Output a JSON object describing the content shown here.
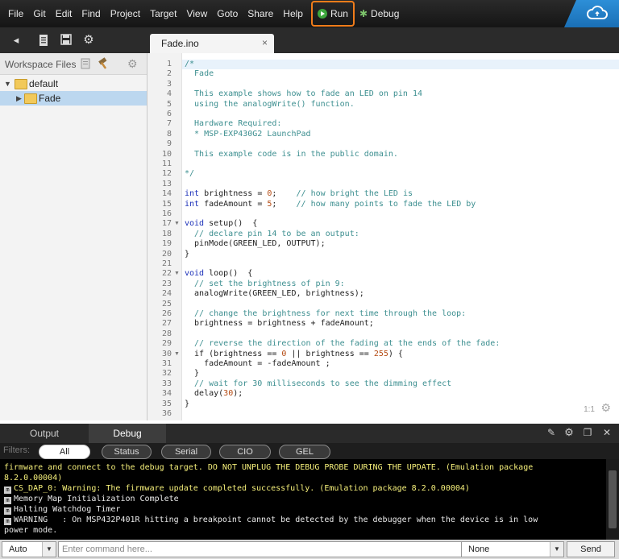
{
  "menu": {
    "items": [
      "File",
      "Git",
      "Edit",
      "Find",
      "Project",
      "Target",
      "View",
      "Goto",
      "Share",
      "Help"
    ],
    "run_label": "Run",
    "debug_label": "Debug"
  },
  "editor": {
    "tab_title": "Fade.ino",
    "cursor_position": "1:1",
    "line_numbers": [
      "1",
      "2",
      "3",
      "4",
      "5",
      "6",
      "7",
      "8",
      "9",
      "10",
      "11",
      "12",
      "13",
      "14",
      "15",
      "16",
      "17",
      "18",
      "19",
      "20",
      "21",
      "22",
      "23",
      "24",
      "25",
      "26",
      "27",
      "28",
      "29",
      "30",
      "31",
      "32",
      "33",
      "34",
      "35",
      "36"
    ]
  },
  "sidebar": {
    "title": "Workspace Files",
    "tree": [
      {
        "label": "default"
      },
      {
        "label": "Fade"
      }
    ]
  },
  "code_lines": [
    {
      "text": "/*",
      "cls": "cm"
    },
    {
      "text": "  Fade",
      "cls": "cm"
    },
    {
      "text": "",
      "cls": "cm"
    },
    {
      "text": "  This example shows how to fade an LED on pin 14",
      "cls": "cm"
    },
    {
      "text": "  using the analogWrite() function.",
      "cls": "cm"
    },
    {
      "text": "",
      "cls": "cm"
    },
    {
      "text": "  Hardware Required:",
      "cls": "cm"
    },
    {
      "text": "  * MSP-EXP430G2 LaunchPad",
      "cls": "cm"
    },
    {
      "text": "",
      "cls": "cm"
    },
    {
      "text": "  This example code is in the public domain.",
      "cls": "cm"
    },
    {
      "text": "",
      "cls": "cm"
    },
    {
      "text": "*/",
      "cls": "cm"
    },
    {
      "text": "",
      "cls": ""
    },
    {
      "text": "",
      "cls": "",
      "parts": [
        [
          "kw",
          "int"
        ],
        [
          "",
          "brightness = "
        ],
        [
          "nm",
          "0"
        ],
        [
          "",
          ";    "
        ],
        [
          "cm",
          "// how bright the LED is"
        ]
      ]
    },
    {
      "text": "",
      "cls": "",
      "parts": [
        [
          "kw",
          "int"
        ],
        [
          "",
          "fadeAmount = "
        ],
        [
          "nm",
          "5"
        ],
        [
          "",
          ";    "
        ],
        [
          "cm",
          "// how many points to fade the LED by"
        ]
      ]
    },
    {
      "text": "",
      "cls": ""
    },
    {
      "text": "",
      "cls": "",
      "parts": [
        [
          "kw",
          "void"
        ],
        [
          "",
          "setup()  {"
        ]
      ]
    },
    {
      "text": "  // declare pin 14 to be an output:",
      "cls": "cm"
    },
    {
      "text": "  pinMode(GREEN_LED, OUTPUT);",
      "cls": ""
    },
    {
      "text": "}",
      "cls": ""
    },
    {
      "text": "",
      "cls": ""
    },
    {
      "text": "",
      "cls": "",
      "parts": [
        [
          "kw",
          "void"
        ],
        [
          "",
          "loop()  {"
        ]
      ]
    },
    {
      "text": "  // set the brightness of pin 9:",
      "cls": "cm"
    },
    {
      "text": "  analogWrite(GREEN_LED, brightness);",
      "cls": ""
    },
    {
      "text": "",
      "cls": ""
    },
    {
      "text": "  // change the brightness for next time through the loop:",
      "cls": "cm"
    },
    {
      "text": "  brightness = brightness + fadeAmount;",
      "cls": ""
    },
    {
      "text": "",
      "cls": ""
    },
    {
      "text": "  // reverse the direction of the fading at the ends of the fade:",
      "cls": "cm"
    },
    {
      "text": "",
      "cls": "",
      "parts": [
        [
          "",
          "  if (brightness == "
        ],
        [
          "nm",
          "0"
        ],
        [
          "",
          " || brightness == "
        ],
        [
          "nm",
          "255"
        ],
        [
          "",
          ") {"
        ]
      ]
    },
    {
      "text": "    fadeAmount = -fadeAmount ;",
      "cls": ""
    },
    {
      "text": "  }",
      "cls": ""
    },
    {
      "text": "  // wait for 30 milliseconds to see the dimming effect",
      "cls": "cm"
    },
    {
      "text": "",
      "cls": "",
      "parts": [
        [
          "",
          "  delay("
        ],
        [
          "nm",
          "30"
        ],
        [
          "",
          ");"
        ]
      ]
    },
    {
      "text": "}",
      "cls": ""
    },
    {
      "text": "",
      "cls": ""
    }
  ],
  "fold_lines": [
    17,
    22,
    30
  ],
  "bottom": {
    "tabs": [
      "Output",
      "Debug"
    ],
    "active_tab": "Debug",
    "filters_label": "Filters:",
    "filter_pills": [
      "All",
      "Status",
      "Serial",
      "CIO",
      "GEL"
    ],
    "console_lines": [
      {
        "text": "firmware and connect to the debug target. DO NOT UNPLUG THE DEBUG PROBE DURING THE UPDATE. (Emulation package",
        "color": "yellow",
        "icon": false
      },
      {
        "text": "8.2.0.00004)",
        "color": "yellow",
        "icon": false
      },
      {
        "text": "CS_DAP_0: Warning: The firmware update completed successfully. (Emulation package 8.2.0.00004)",
        "color": "yellow",
        "icon": true
      },
      {
        "text": "Memory Map Initialization Complete",
        "color": "white",
        "icon": true
      },
      {
        "text": "Halting Watchdog Timer",
        "color": "white",
        "icon": true
      },
      {
        "text": "WARNING   : On MSP432P401R hitting a breakpoint cannot be detected by the debugger when the device is in low",
        "color": "white",
        "icon": true
      },
      {
        "text": "power mode.",
        "color": "white",
        "icon": false
      }
    ]
  },
  "command": {
    "mode_value": "Auto",
    "placeholder": "Enter command here...",
    "target_value": "None",
    "send_label": "Send"
  }
}
